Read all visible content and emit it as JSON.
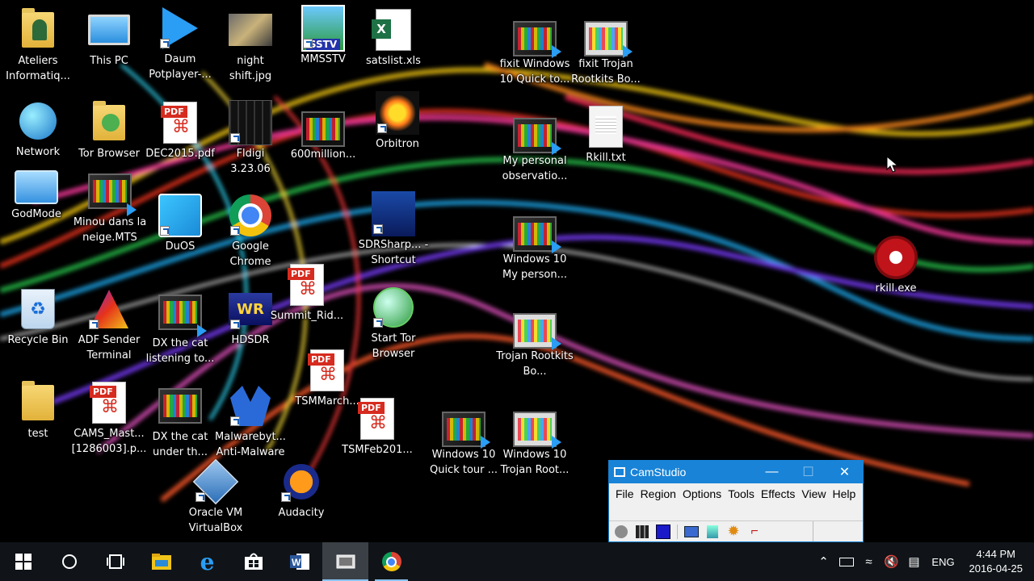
{
  "desktop": {
    "icons": [
      {
        "id": "ateliers",
        "label": "Ateliers Informatiq...",
        "icon": "user-folder-icon"
      },
      {
        "id": "thispc",
        "label": "This PC",
        "icon": "computer-icon"
      },
      {
        "id": "daum",
        "label": "Daum Potplayer-...",
        "icon": "potplayer-icon"
      },
      {
        "id": "night",
        "label": "night shift.jpg",
        "icon": "image-file-icon"
      },
      {
        "id": "mmsstv",
        "label": "MMSSTV",
        "icon": "sstv-icon"
      },
      {
        "id": "satslist",
        "label": "satslist.xls",
        "icon": "excel-file-icon"
      },
      {
        "id": "fixit1",
        "label": "fixit Windows 10 Quick to...",
        "icon": "video-file-icon"
      },
      {
        "id": "fixit2",
        "label": "fixit Trojan Rootkits Bo...",
        "icon": "video-file-icon"
      },
      {
        "id": "network",
        "label": "Network",
        "icon": "network-icon"
      },
      {
        "id": "tor",
        "label": "Tor Browser",
        "icon": "tor-folder-icon"
      },
      {
        "id": "dec2015",
        "label": "DEC2015.pdf",
        "icon": "pdf-file-icon"
      },
      {
        "id": "fldigi",
        "label": "Fldigi 3.23.06",
        "icon": "fldigi-icon"
      },
      {
        "id": "600m",
        "label": "600million...",
        "icon": "video-file-icon"
      },
      {
        "id": "orbitron",
        "label": "Orbitron",
        "icon": "orbitron-icon"
      },
      {
        "id": "myobs",
        "label": "My personal observatio...",
        "icon": "video-file-icon"
      },
      {
        "id": "rkilltxt",
        "label": "Rkill.txt",
        "icon": "text-file-icon"
      },
      {
        "id": "godmode",
        "label": "GodMode",
        "icon": "control-panel-icon"
      },
      {
        "id": "minou",
        "label": "Minou dans la neige.MTS",
        "icon": "video-file-icon"
      },
      {
        "id": "duos",
        "label": "DuOS",
        "icon": "duos-icon"
      },
      {
        "id": "chrome",
        "label": "Google Chrome",
        "icon": "chrome-icon"
      },
      {
        "id": "sdrsharp",
        "label": "SDRSharp... - Shortcut",
        "icon": "sdrsharp-icon"
      },
      {
        "id": "win10my",
        "label": "Windows 10 My person...",
        "icon": "video-file-icon"
      },
      {
        "id": "rkillexe",
        "label": "rkill.exe",
        "icon": "rkill-icon"
      },
      {
        "id": "summit",
        "label": "Summit_Rid...",
        "icon": "pdf-file-icon"
      },
      {
        "id": "recycle",
        "label": "Recycle Bin",
        "icon": "recycle-bin-icon"
      },
      {
        "id": "adf",
        "label": "ADF Sender Terminal",
        "icon": "adf-icon"
      },
      {
        "id": "dxcat1",
        "label": "DX the cat listening to...",
        "icon": "video-file-icon"
      },
      {
        "id": "hdsdr",
        "label": "HDSDR",
        "icon": "hdsdr-icon"
      },
      {
        "id": "starttor",
        "label": "Start Tor Browser",
        "icon": "tor-globe-icon"
      },
      {
        "id": "trojan",
        "label": "Trojan Rootkits Bo...",
        "icon": "video-file-icon"
      },
      {
        "id": "tsmmarch",
        "label": "TSMMarch...",
        "icon": "pdf-file-icon"
      },
      {
        "id": "test",
        "label": "test",
        "icon": "folder-icon"
      },
      {
        "id": "cams",
        "label": "CAMS_Mast... [1286003].p...",
        "icon": "pdf-file-icon"
      },
      {
        "id": "dxcat2",
        "label": "DX the cat under th...",
        "icon": "video-file-icon"
      },
      {
        "id": "malware",
        "label": "Malwarebyt... Anti-Malware",
        "icon": "malwarebytes-icon"
      },
      {
        "id": "tsmfeb",
        "label": "TSMFeb201...",
        "icon": "pdf-file-icon"
      },
      {
        "id": "win10quick",
        "label": "Windows 10 Quick tour ...",
        "icon": "video-file-icon"
      },
      {
        "id": "win10trojan",
        "label": "Windows 10 Trojan Root...",
        "icon": "video-file-icon"
      },
      {
        "id": "virtualbox",
        "label": "Oracle VM VirtualBox",
        "icon": "virtualbox-icon"
      },
      {
        "id": "audacity",
        "label": "Audacity",
        "icon": "audacity-icon"
      }
    ]
  },
  "camstudio": {
    "title": "CamStudio",
    "menu": [
      "File",
      "Region",
      "Options",
      "Tools",
      "Effects",
      "View",
      "Help"
    ],
    "toolbar": [
      "record-icon",
      "pause-icon",
      "stop-icon",
      "annotation-icon",
      "region-icon",
      "settings-icon",
      "minimize-view-icon"
    ]
  },
  "taskbar": {
    "apps": [
      "start-icon",
      "cortana-icon",
      "task-view-icon",
      "file-explorer-icon",
      "edge-icon",
      "store-icon",
      "word-icon",
      "camstudio-icon",
      "chrome-icon"
    ],
    "tray": {
      "language": "ENG",
      "time": "4:44 PM",
      "date": "2016-04-25"
    }
  },
  "colors": {
    "accent": "#1883d7",
    "taskbar": "#101418"
  }
}
